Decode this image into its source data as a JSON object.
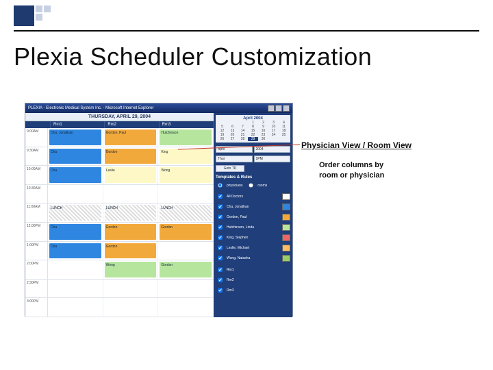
{
  "slide": {
    "title": "Plexia Scheduler Customization"
  },
  "annotation": {
    "heading": "Physician View / Room View",
    "body_line1": "Order columns by",
    "body_line2": "room or physician"
  },
  "window": {
    "title": "PLEXIA - Electronic Medical System Inc. - Microsoft Internet Explorer"
  },
  "scheduler": {
    "date": "THURSDAY, APRIL 29, 2004",
    "columns": [
      "Rm1",
      "Rm2",
      "Rm3"
    ],
    "timeslots": [
      "9:00AM",
      "9:30AM",
      "10:00AM",
      "10:30AM",
      "11:00AM",
      "12:00PM",
      "1:00PM",
      "2:00PM",
      "2:30PM",
      "3:00PM"
    ]
  },
  "calendar": {
    "month_label": "April 2004",
    "weeks": [
      [
        "",
        "",
        "",
        "1",
        "2",
        "3",
        "4"
      ],
      [
        "5",
        "6",
        "7",
        "8",
        "9",
        "10",
        "11"
      ],
      [
        "12",
        "13",
        "14",
        "15",
        "16",
        "17",
        "18"
      ],
      [
        "19",
        "20",
        "21",
        "22",
        "23",
        "24",
        "25"
      ],
      [
        "26",
        "27",
        "28",
        "29",
        "30",
        "",
        ""
      ]
    ],
    "today": "29",
    "month_select": "April",
    "year_select": "2004",
    "day_select": "Thur",
    "meridiem_select": "1PM",
    "go_label": "Goto TD"
  },
  "panel": {
    "section_label": "Templates & Rules",
    "view_options": {
      "opt1": "physicians",
      "opt2": "rooms"
    },
    "doctors": [
      {
        "name": "All Doctors",
        "color": "#ffffff"
      },
      {
        "name": "Chu, Jonathan",
        "color": "#2f86e0"
      },
      {
        "name": "Gordon, Paul",
        "color": "#f2a93c"
      },
      {
        "name": "Hutchinson, Linda",
        "color": "#b6e69e"
      },
      {
        "name": "King, Stephen",
        "color": "#e66"
      },
      {
        "name": "Leslie, Michael",
        "color": "#fb6"
      },
      {
        "name": "Wong, Natasha",
        "color": "#9c6"
      }
    ],
    "rooms": [
      {
        "name": "Rm1"
      },
      {
        "name": "Rm2"
      },
      {
        "name": "Rm3"
      }
    ]
  },
  "appointments": {
    "a1": "Chu, Jonathan",
    "a2": "Gordon, Paul",
    "a3": "Hutchinson",
    "a4": "Chu",
    "a5": "Gordon",
    "a6": "King",
    "a7": "Chu",
    "a8": "Leslie",
    "a9": "Wong",
    "lunch1": "LUNCH",
    "lunch2": "LUNCH",
    "lunch3": "LUNCH",
    "a10": "Chu",
    "a11": "Gordon",
    "a12": "Gordon",
    "a13": "Chu",
    "a14": "Gordon",
    "a15": "Wong",
    "a16": "Gordon"
  }
}
